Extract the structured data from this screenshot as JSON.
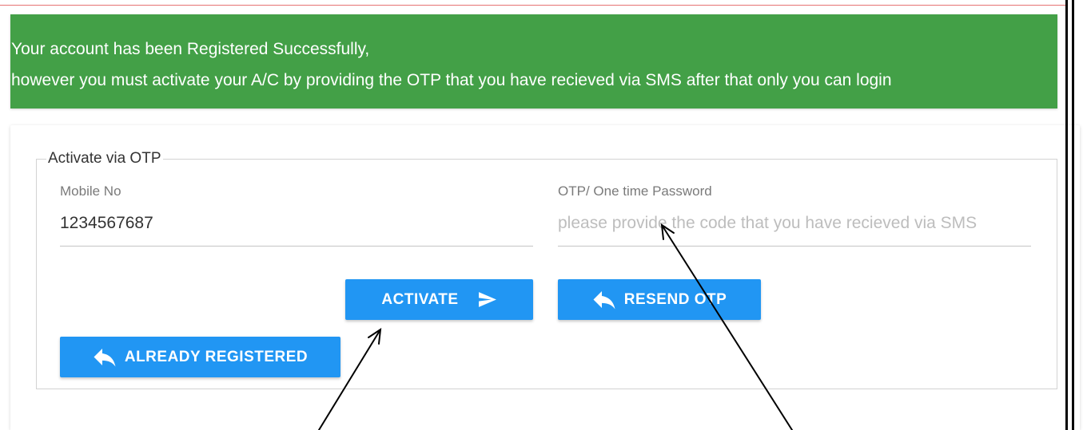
{
  "theme": {
    "alert_bg": "#43a047",
    "button_bg": "#2196f3",
    "accent_rule": "#e57373"
  },
  "alert": {
    "line1": "Your account has been Registered Successfully,",
    "line2": "however you must activate your A/C by providing the OTP that you have recieved via SMS after that only you can login"
  },
  "form": {
    "legend": "Activate via OTP",
    "mobile": {
      "label": "Mobile No",
      "value": "1234567687"
    },
    "otp": {
      "label": "OTP/ One time Password",
      "placeholder": "please provide the code that you have recieved via SMS"
    },
    "buttons": {
      "activate": {
        "label": "ACTIVATE",
        "icon": "send-icon"
      },
      "resend": {
        "label": "RESEND OTP",
        "icon": "reply-icon"
      },
      "already_registered": {
        "label": "ALREADY REGISTERED",
        "icon": "reply-icon"
      }
    }
  }
}
